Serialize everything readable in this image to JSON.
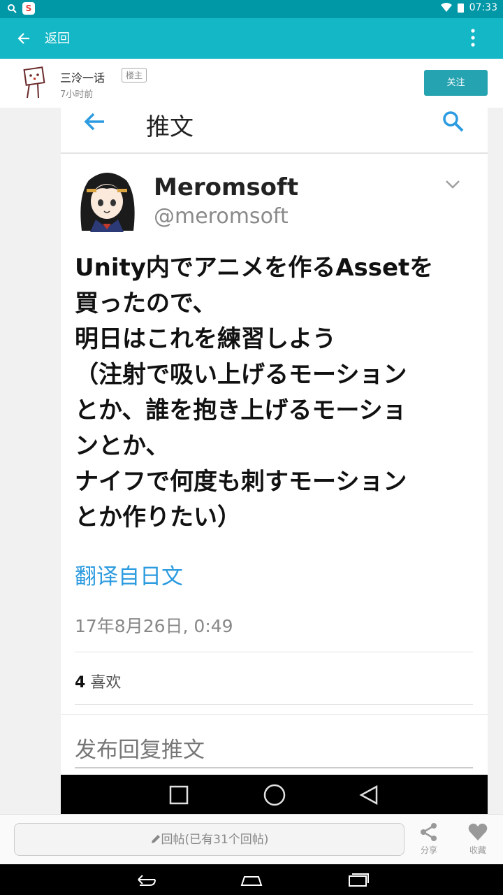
{
  "status_bar": {
    "time": "07:33",
    "app_icon_glyph": "S",
    "icons": [
      "search-icon",
      "app-icon",
      "wifi-icon",
      "battery-icon"
    ]
  },
  "app_bar": {
    "back_label": "返回",
    "icons": [
      "back-arrow-icon",
      "more-vert-icon"
    ]
  },
  "post_author": {
    "name": "三泠一话",
    "tag": "楼主",
    "time": "7小时前",
    "follow_label": "关注"
  },
  "tweet_screenshot": {
    "header_title": "推文",
    "user": {
      "display_name": "Meromsoft",
      "handle": "@meromsoft"
    },
    "body": "Unity内でアニメを作るAssetを\n買ったので、\n明日はこれを練習しよう\n（注射で吸い上げるモーション\nとか、誰を抱き上げるモーショ\nンとか、\nナイフで何度も刺すモーション\nとか作りたい）",
    "translate_label": "翻译自日文",
    "date": "17年8月26日, 0:49",
    "likes_count": "4",
    "likes_label": "喜欢",
    "reply_placeholder": "发布回复推文"
  },
  "reply_bar": {
    "placeholder": "回帖(已有31个回帖)",
    "share_label": "分享",
    "favorite_label": "收藏"
  },
  "colors": {
    "status_bar": "#0097a7",
    "app_bar": "#13b7c5",
    "follow_button": "#26a3b0",
    "twitter_blue": "#2c9be0"
  }
}
